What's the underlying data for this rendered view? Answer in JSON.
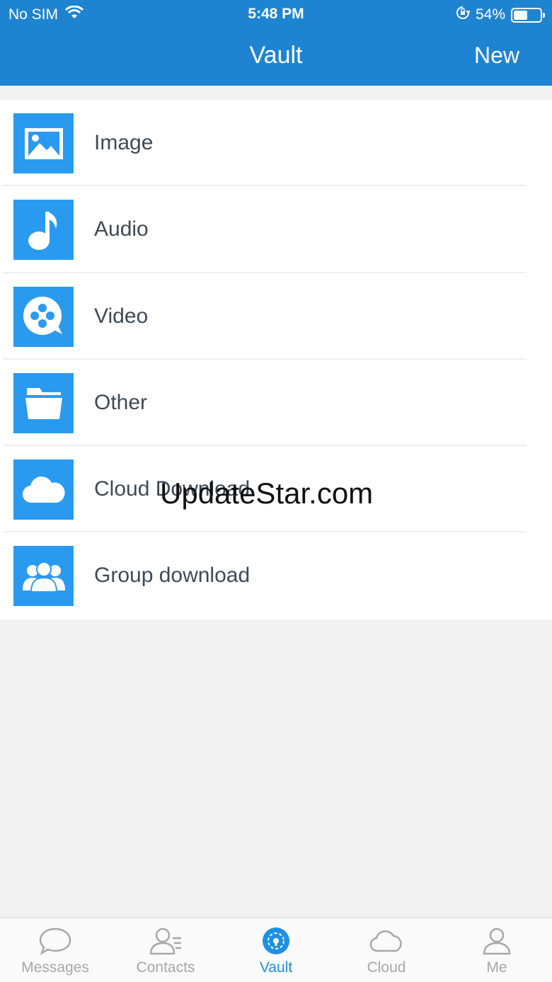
{
  "status_bar": {
    "carrier": "No SIM",
    "time": "5:48 PM",
    "battery_percent": "54%",
    "battery_level": 0.54,
    "icons": [
      "wifi-icon",
      "orientation-lock-icon",
      "battery-icon"
    ]
  },
  "nav": {
    "title": "Vault",
    "new_label": "New"
  },
  "list": {
    "items": [
      {
        "label": "Image",
        "icon": "image-icon"
      },
      {
        "label": "Audio",
        "icon": "music-note-icon"
      },
      {
        "label": "Video",
        "icon": "film-reel-icon"
      },
      {
        "label": "Other",
        "icon": "folder-icon"
      },
      {
        "label": "Cloud Download",
        "icon": "cloud-icon"
      },
      {
        "label": "Group download",
        "icon": "group-icon"
      }
    ]
  },
  "watermark": "UpdateStar.com",
  "tabbar": {
    "tabs": [
      {
        "label": "Messages",
        "icon": "chat-bubble-icon",
        "active": false
      },
      {
        "label": "Contacts",
        "icon": "contacts-icon",
        "active": false
      },
      {
        "label": "Vault",
        "icon": "vault-icon",
        "active": true
      },
      {
        "label": "Cloud",
        "icon": "cloud-outline-icon",
        "active": false
      },
      {
        "label": "Me",
        "icon": "person-icon",
        "active": false
      }
    ]
  },
  "colors": {
    "header": "#1e84d2",
    "tile": "#2a9af0",
    "active_tab": "#1e90e6",
    "inactive_tab": "#a8a8a8"
  }
}
